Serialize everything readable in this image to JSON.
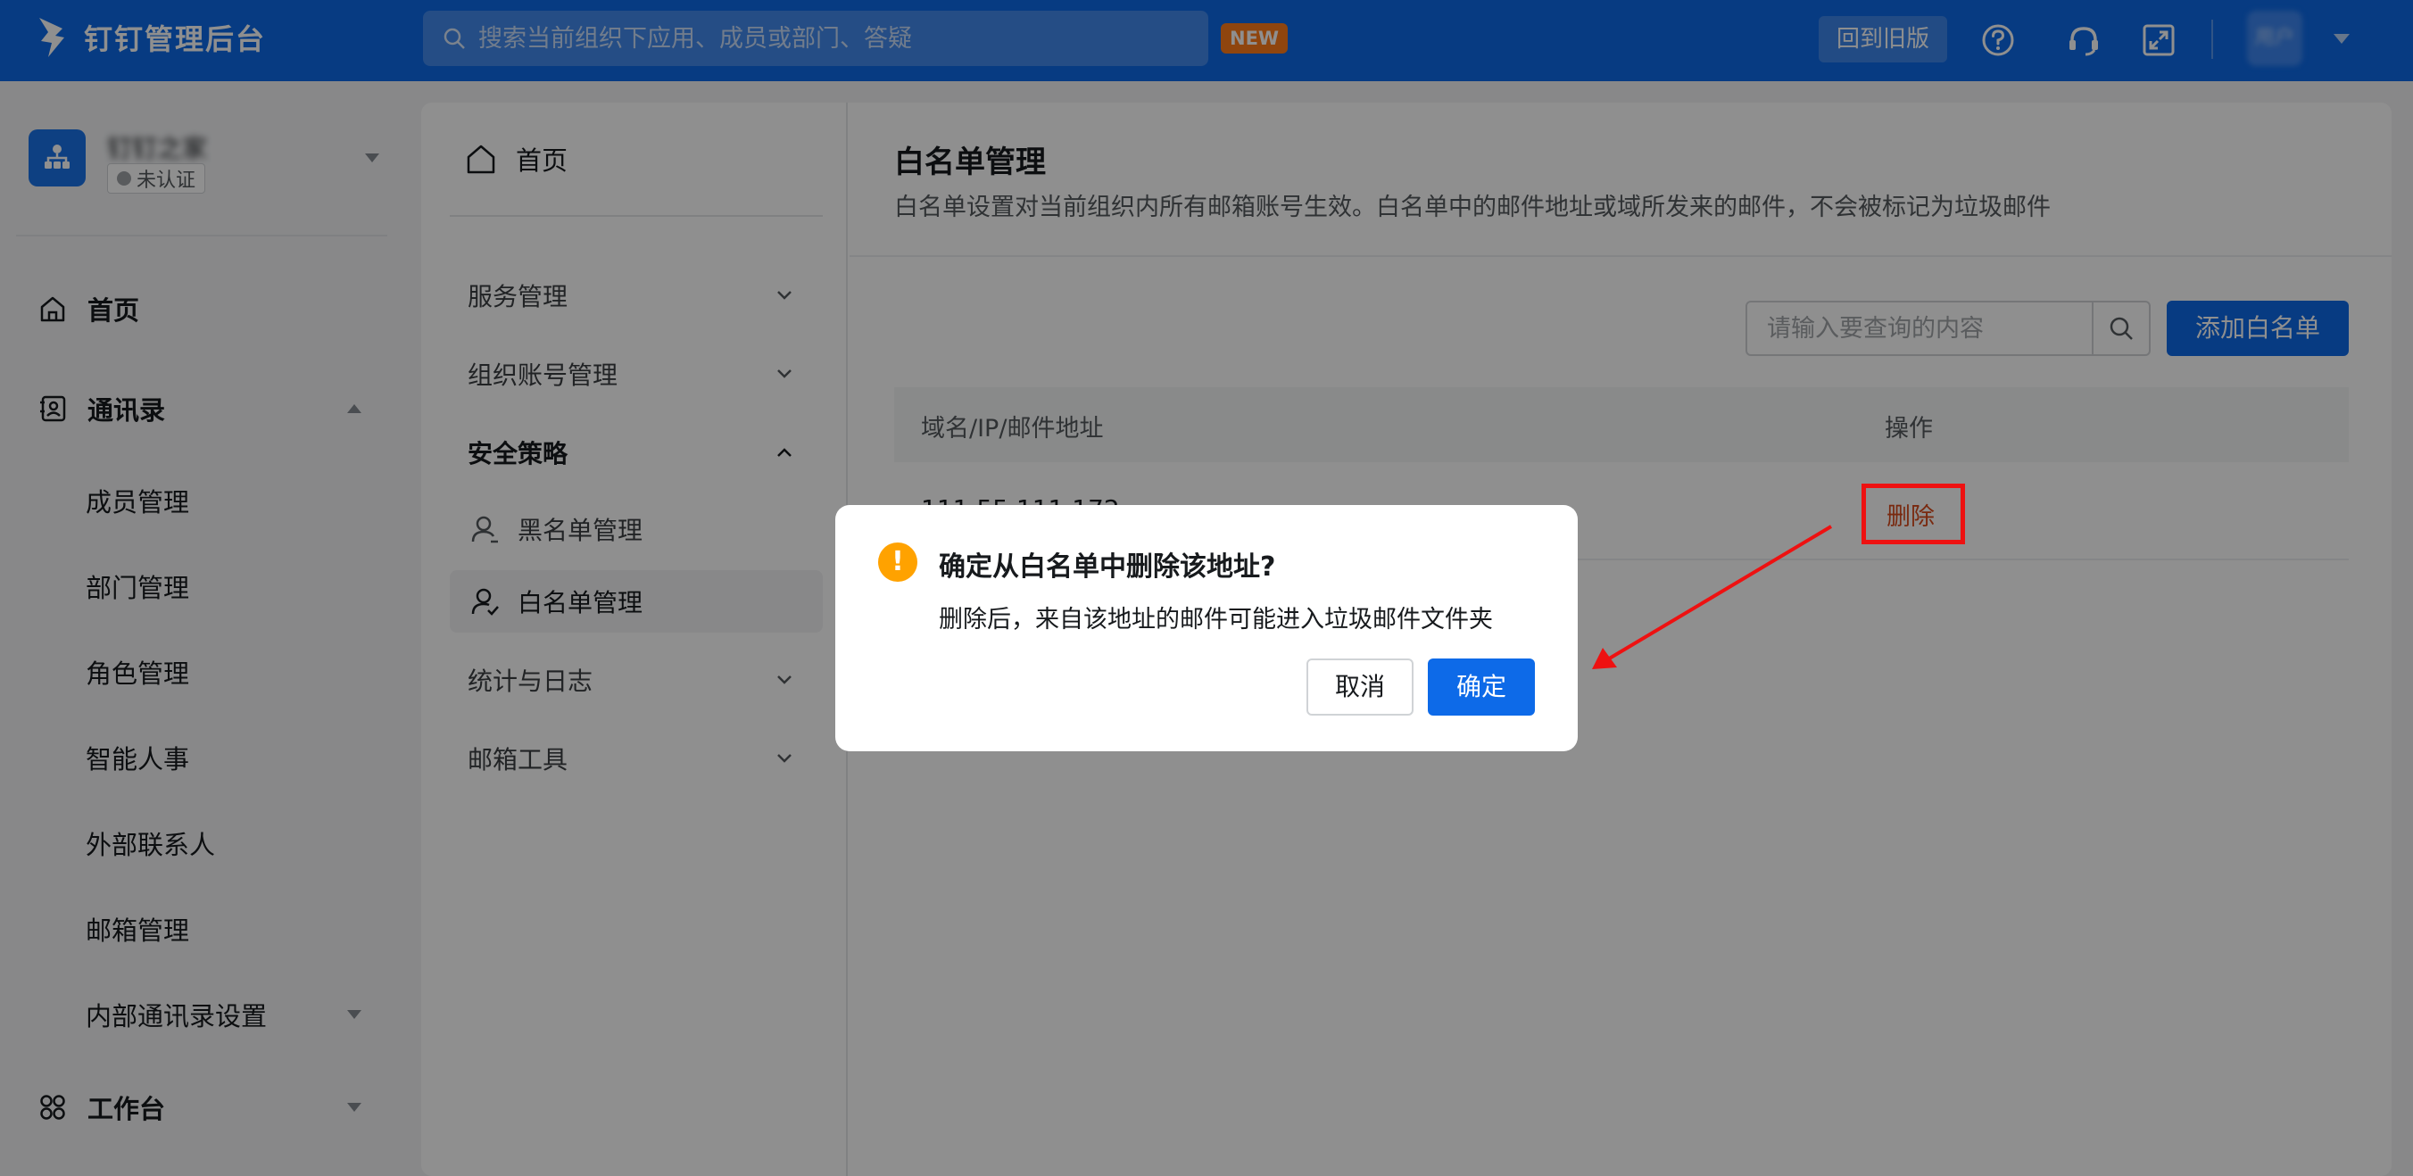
{
  "app": {
    "title": "钉钉管理后台"
  },
  "topbar": {
    "search_placeholder": "搜索当前组织下应用、成员或部门、答疑",
    "new_badge": "NEW",
    "old_version_label": "回到旧版",
    "user_name": "用户"
  },
  "org": {
    "name": "钉钉之家",
    "status": "未认证"
  },
  "leftnav": {
    "home": "首页",
    "contacts": "通讯录",
    "contacts_items": [
      "成员管理",
      "部门管理",
      "角色管理",
      "智能人事",
      "外部联系人",
      "邮箱管理",
      "内部通讯录设置"
    ],
    "workbench": "工作台"
  },
  "subnav": {
    "home": "首页",
    "items": [
      "服务管理",
      "组织账号管理",
      "安全策略",
      "统计与日志",
      "邮箱工具"
    ],
    "security_children": [
      "黑名单管理",
      "白名单管理"
    ]
  },
  "content": {
    "title": "白名单管理",
    "description": "白名单设置对当前组织内所有邮箱账号生效。白名单中的邮件地址或域所发来的邮件，不会被标记为垃圾邮件",
    "query_placeholder": "请输入要查询的内容",
    "add_button": "添加白名单",
    "table": {
      "headers": [
        "域名/IP/邮件地址",
        "操作"
      ],
      "rows": [
        {
          "address": "111.55.111.172",
          "action": "删除"
        }
      ]
    }
  },
  "dialog": {
    "title": "确定从白名单中删除该地址?",
    "message": "删除后，来自该地址的邮件可能进入垃圾邮件文件夹",
    "cancel": "取消",
    "confirm": "确定"
  },
  "colors": {
    "brand": "#0d6ae8",
    "warning": "#ffa200",
    "danger": "#d84a1b",
    "annotation": "#ee1111"
  },
  "icons": [
    "logo-icon",
    "search-icon",
    "help-icon",
    "headset-icon",
    "fullscreen-icon",
    "home-icon",
    "contacts-icon",
    "workbench-icon",
    "blacklist-user-icon",
    "whitelist-user-icon",
    "warning-icon"
  ]
}
